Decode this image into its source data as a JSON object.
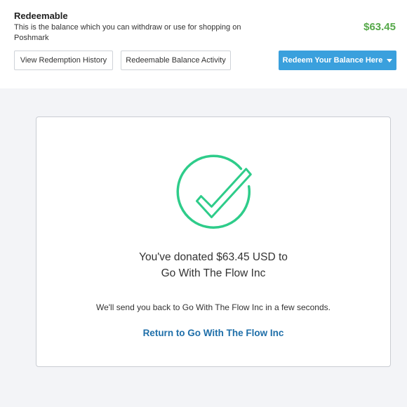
{
  "redeemable": {
    "title": "Redeemable",
    "description": "This is the balance which you can withdraw or use for shopping on Poshmark",
    "amount": "$63.45"
  },
  "buttons": {
    "history": "View Redemption History",
    "activity": "Redeemable Balance Activity",
    "redeem": "Redeem Your Balance Here"
  },
  "confirmation": {
    "line1": "You've donated $63.45 USD to",
    "line2": "Go With The Flow Inc",
    "redirect_note": "We'll send you back to Go With The Flow Inc in a few seconds.",
    "return_link": "Return to Go With The Flow Inc"
  },
  "colors": {
    "check": "#2ecc8a",
    "amount": "#56a94a",
    "primary_button": "#3aa0dd",
    "link": "#1f6fa9"
  },
  "icons": {
    "success": "checkmark-circle-icon",
    "dropdown": "caret-down-icon"
  }
}
